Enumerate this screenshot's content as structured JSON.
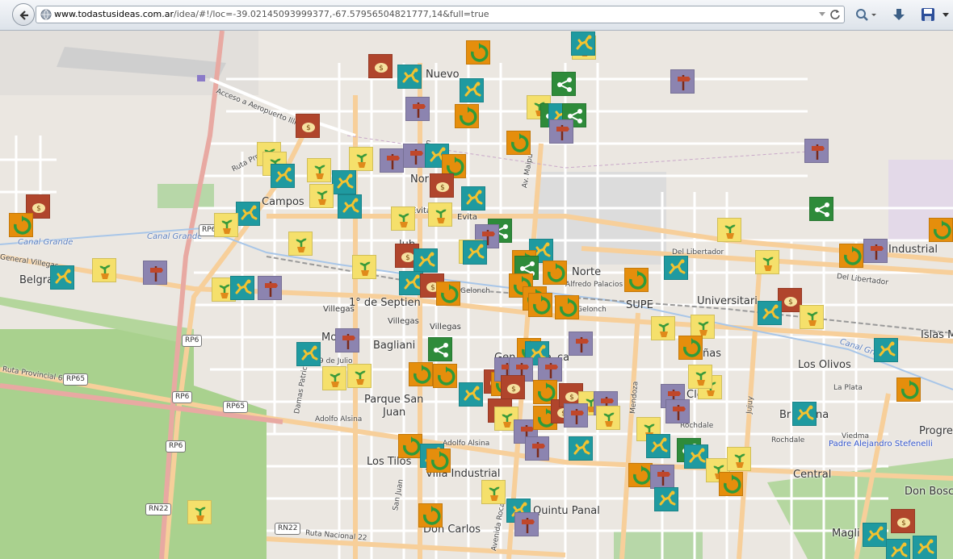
{
  "browser": {
    "url_prefix": "www.todastusideas.com.ar",
    "url_rest": "/idea/#!/loc=-39.02145093999377,-67.57956504821777,14&full=true"
  },
  "map": {
    "places": [
      "Nuevo",
      "Nor",
      "Campos",
      "Evita",
      "Evita",
      "Belgra",
      "1° de Septien",
      "Villegas",
      "Villegas",
      "Villegas",
      "Bagliani",
      "Gen",
      "ca",
      "Norte",
      "SUPE",
      "Universitari",
      "Industrial",
      "Islas M",
      "Los Olivos",
      "ñas",
      "Cleros",
      "Br",
      "na",
      "Progre",
      "Central",
      "Don Bosc",
      "Parque San",
      "Juan",
      "Los Tilos",
      "Villa Industrial",
      "Quintu Panal",
      "Don Carlos",
      "Magli",
      "Mo",
      "lub",
      "ca"
    ],
    "roads": [
      "Acceso a Aeropuerto Illia",
      "Ruta Provincial",
      "General Villegas",
      "Canal Grande",
      "Canal Grande",
      "Canal Grande",
      "Gelonch",
      "Gelonch",
      "Alfredo Palacios",
      "Del Libertador",
      "Del Libertador",
      "Ruta Provincial 65",
      "Damas Patricias",
      "9 de Julio",
      "Adolfo Alsina",
      "Adolfo Alsina",
      "Mendoza",
      "Jujuy",
      "La Plata",
      "Rochdale",
      "Rochdale",
      "Viedma",
      "Ruta Nacional 22",
      "Av. Maipu",
      "Avenida Roca",
      "San Juan",
      "Juan"
    ],
    "shields": [
      "RP6",
      "RP6",
      "RP6",
      "RP65",
      "RP65",
      "RN22",
      "RN22",
      "RP6"
    ],
    "special_label": "Padre Alejandro Stefenelli"
  },
  "colors": {
    "green": "#2e8b3a",
    "teal": "#1f9aa0",
    "orange": "#e58e0c",
    "yellow": "#f5e06b",
    "red": "#b0452c",
    "purple": "#8c84b0",
    "road": "#f7cf9a",
    "park": "#b7d7a8",
    "field": "#a9d18e"
  },
  "icons": {
    "green": "share-icon",
    "teal": "running-icon",
    "orange": "recycle-icon",
    "yellow": "plant-icon",
    "red": "piggy-bank-icon",
    "purple": "signpost-icon"
  }
}
